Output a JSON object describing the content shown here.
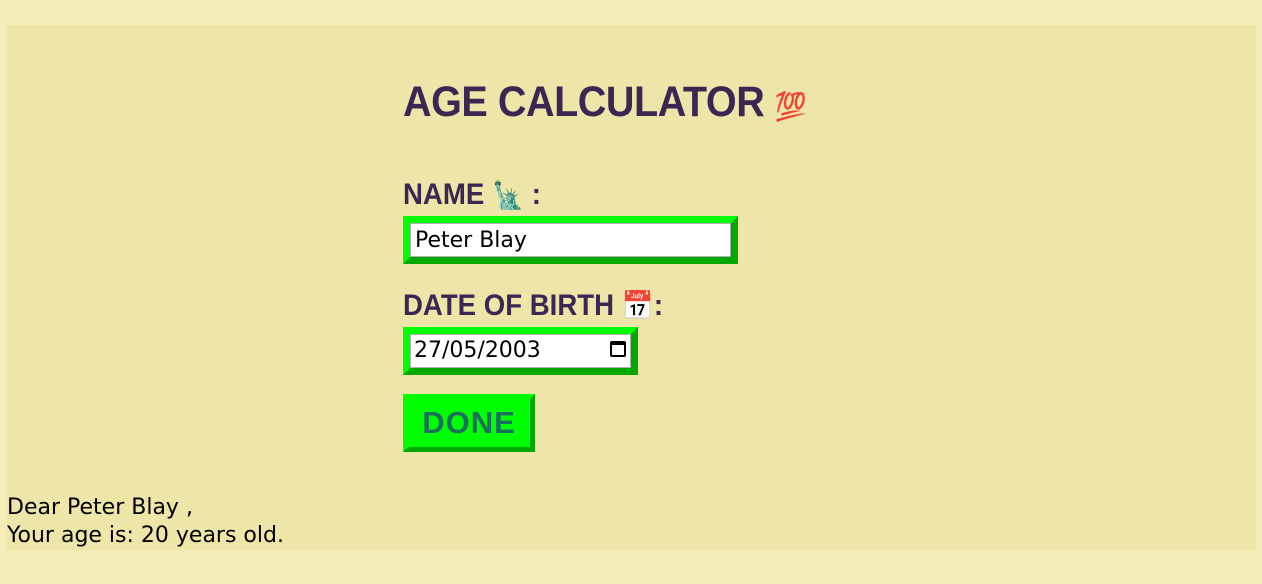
{
  "title": {
    "text": "AGE CALCULATOR",
    "emoji": "💯"
  },
  "name_field": {
    "label": "NAME",
    "emoji": "🗽",
    "colon": ":",
    "value": "Peter Blay"
  },
  "dob_field": {
    "label": "DATE OF BIRTH",
    "emoji": "📅",
    "colon": ":",
    "value": "27/05/2003"
  },
  "done_button": {
    "label": "DONE"
  },
  "result": {
    "greeting_prefix": "Dear",
    "name": "Peter Blay",
    "greeting_suffix": ",",
    "age_line": "Your age is: 20 years old."
  },
  "colors": {
    "page_background": "#f3ecb6",
    "card_background": "#ede6a8",
    "heading": "#3d2653",
    "button_green": "#00ff00",
    "button_shadow_green": "#00a800",
    "button_text": "#1a6f5d"
  },
  "icons": {
    "title_icon": "hundred-points-emoji",
    "name_icon": "statue-of-liberty-emoji",
    "dob_icon": "calendar-emoji",
    "date_picker_icon": "calendar-icon"
  }
}
